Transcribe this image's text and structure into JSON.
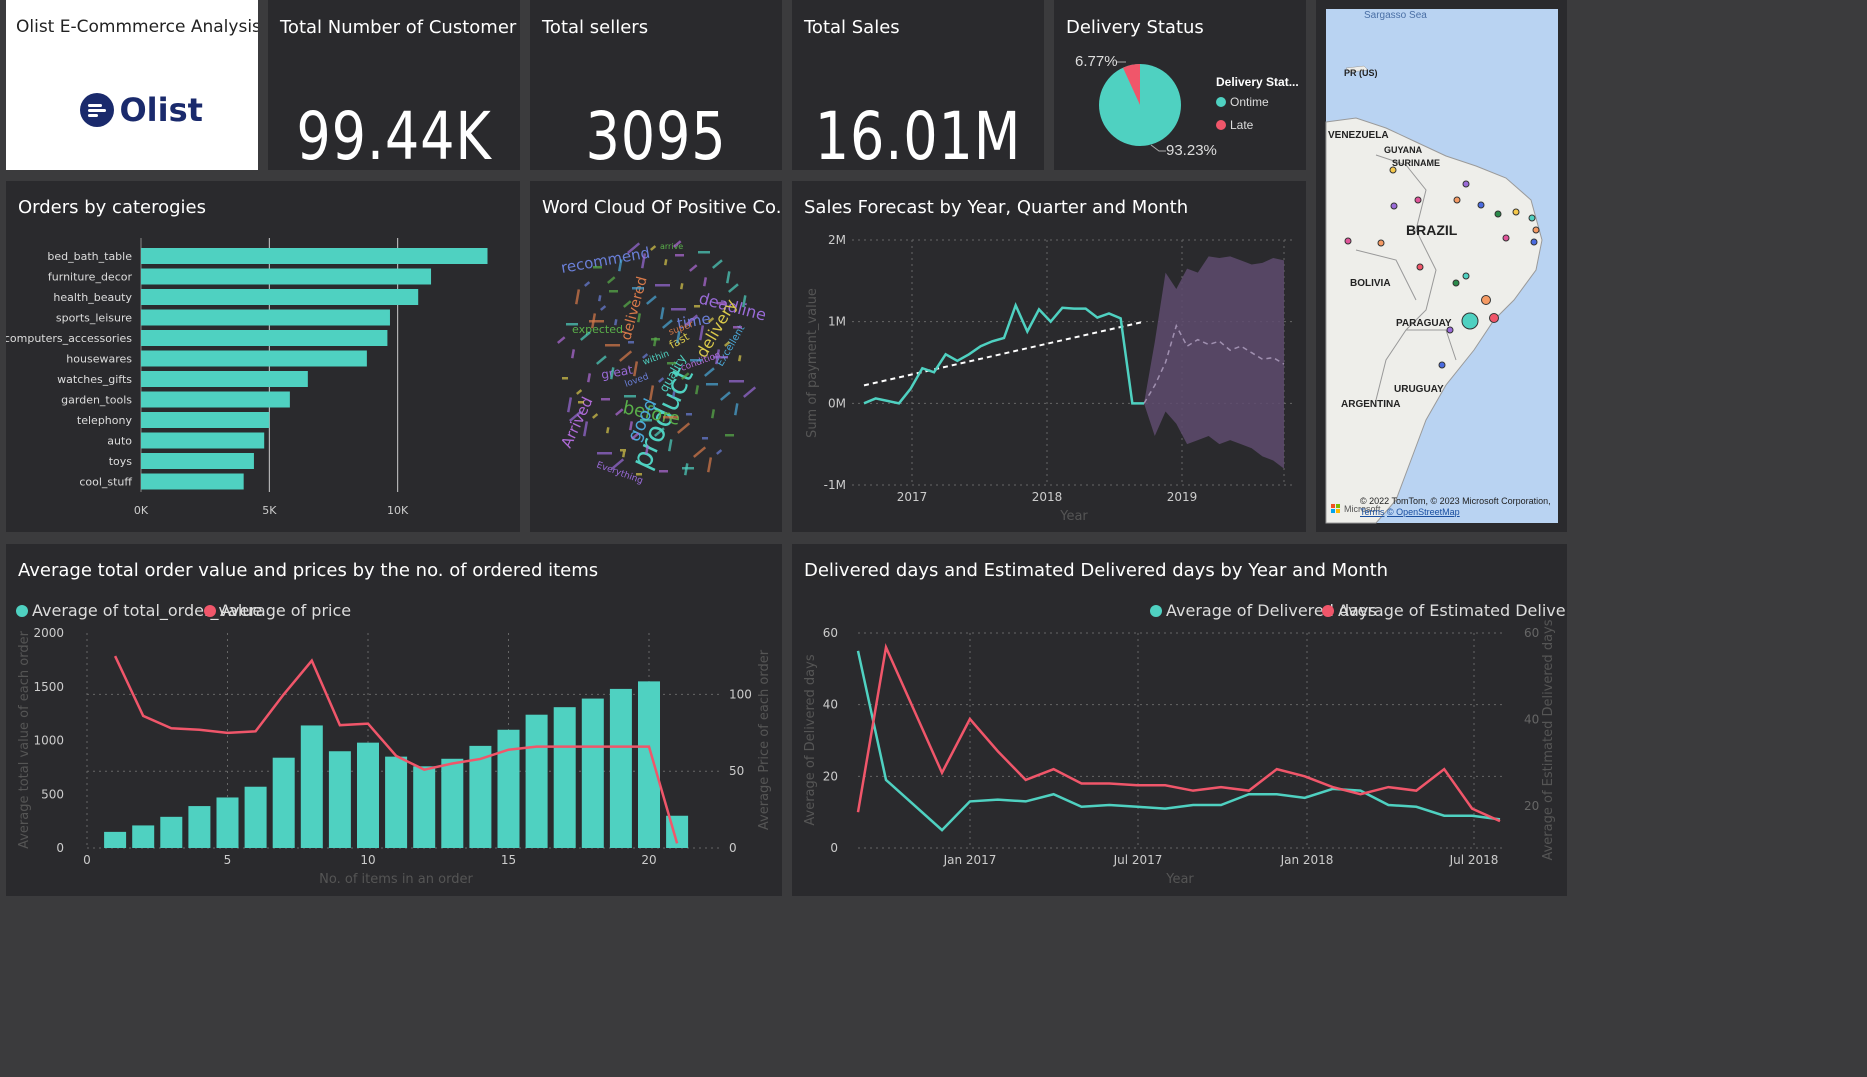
{
  "colors": {
    "teal": "#4fd1c1",
    "red": "#f0566a",
    "purple": "#5e4b6e",
    "panel": "#2a2a2d",
    "bg": "#3b3b3d"
  },
  "header": {
    "title": "Olist E-Commmerce Analysis",
    "logo_text": "Olist"
  },
  "kpis": {
    "customers": {
      "title": "Total Number of Customer",
      "value": "99.44K"
    },
    "sellers": {
      "title": "Total sellers",
      "value": "3095"
    },
    "sales": {
      "title": "Total Sales",
      "value": "16.01M"
    }
  },
  "delivery_status": {
    "title": "Delivery Status",
    "legend_title": "Delivery Stat...",
    "legend": [
      "Ontime",
      "Late"
    ],
    "late_label": "6.77%",
    "ontime_label": "93.23%"
  },
  "wordcloud": {
    "title": "Word Cloud Of Positive Co...",
    "words": [
      "recommend",
      "deadline",
      "product",
      "before",
      "delivery",
      "delivered",
      "good",
      "Arrived",
      "time",
      "great",
      "quality",
      "expected",
      "fast",
      "super",
      "Excellent",
      "condition",
      "loved",
      "Everything",
      "within",
      "arrive"
    ]
  },
  "map": {
    "top_label": "Sargasso Sea",
    "labels": [
      "PR (US)",
      "VENEZUELA",
      "GUYANA",
      "SURINAME",
      "BRAZIL",
      "BOLIVIA",
      "PARAGUAY",
      "URUGUAY",
      "ARGENTINA"
    ],
    "attribution": "© 2022 TomTom, © 2023 Microsoft Corporation,",
    "terms": "Terms",
    "osm": "© OpenStreetMap",
    "ms_logo_text": "Microsoft"
  },
  "chart_data": [
    {
      "id": "orders_by_category",
      "type": "bar",
      "title": "Orders by caterogies",
      "categories": [
        "bed_bath_table",
        "furniture_decor",
        "health_beauty",
        "sports_leisure",
        "computers_accessories",
        "housewares",
        "watches_gifts",
        "garden_tools",
        "telephony",
        "auto",
        "toys",
        "cool_stuff"
      ],
      "values": [
        13500,
        11300,
        10800,
        9700,
        9600,
        8800,
        6500,
        5800,
        5000,
        4800,
        4400,
        4000
      ],
      "xticks": [
        "0K",
        "5K",
        "10K"
      ],
      "xlim": [
        0,
        15000
      ],
      "orientation": "horizontal",
      "color": "#4fd1c1"
    },
    {
      "id": "sales_forecast",
      "type": "line",
      "title": "Sales Forecast by Year, Quarter and Month",
      "xlabel": "Year",
      "ylabel": "Sum of payment_value",
      "yticks": [
        "2M",
        "1M",
        "0M",
        "-1M"
      ],
      "xticks": [
        "2017",
        "2018",
        "2019"
      ],
      "ylim": [
        -1000000,
        2000000
      ],
      "actual": [
        0,
        60000,
        30000,
        0,
        180000,
        430000,
        380000,
        600000,
        520000,
        600000,
        700000,
        760000,
        800000,
        1200000,
        880000,
        1150000,
        1000000,
        1170000,
        1160000,
        1160000,
        1050000,
        1100000,
        1040000,
        0,
        0
      ],
      "forecast": [
        0,
        220000,
        500000,
        950000,
        700000,
        780000,
        720000,
        760000,
        650000,
        700000,
        620000,
        540000,
        560000,
        480000
      ],
      "upper": [
        0,
        750000,
        1600000,
        1400000,
        1650000,
        1600000,
        1800000,
        1780000,
        1800000,
        1750000,
        1700000,
        1720000,
        1780000,
        1750000
      ],
      "lower": [
        0,
        -400000,
        -100000,
        -250000,
        -500000,
        -450000,
        -400000,
        -500000,
        -450000,
        -500000,
        -550000,
        -650000,
        -700000,
        -800000
      ],
      "trend": [
        220000,
        1000000
      ],
      "forecast_band_color": "#5e4b6e"
    },
    {
      "id": "avg_order_value",
      "type": "bar",
      "title": "Average total order value and prices by the no. of ordered items",
      "xlabel": "No. of items in an order",
      "ylabel": "Average total value of each order",
      "y2label": "Average Price of each order",
      "legend": [
        "Average of total_order_value",
        "Average of price"
      ],
      "x": [
        1,
        2,
        3,
        4,
        5,
        6,
        7,
        8,
        9,
        10,
        11,
        12,
        13,
        14,
        15,
        16,
        17,
        18,
        19,
        20,
        21
      ],
      "series": [
        {
          "name": "Average of total_order_value",
          "type": "bar",
          "values": [
            150,
            210,
            290,
            390,
            470,
            570,
            840,
            1140,
            900,
            980,
            850,
            760,
            830,
            950,
            1100,
            1240,
            1310,
            1390,
            1480,
            1550,
            300
          ]
        },
        {
          "name": "Average of price",
          "type": "line",
          "axis": "right",
          "values": [
            125,
            86,
            78,
            77,
            75,
            76,
            100,
            122,
            80,
            81,
            60,
            51,
            55,
            58,
            64,
            66,
            66,
            66,
            66,
            66,
            3
          ]
        }
      ],
      "yticks": [
        "2000",
        "1500",
        "1000",
        "500",
        "0"
      ],
      "y2ticks": [
        "100",
        "50",
        "0"
      ],
      "xticks": [
        "0",
        "5",
        "10",
        "15",
        "20"
      ],
      "ylim": [
        0,
        2000
      ],
      "y2lim": [
        0,
        140
      ]
    },
    {
      "id": "delivered_days",
      "type": "line",
      "title": "Delivered days and Estimated Delivered days by Year and Month",
      "xlabel": "Year",
      "ylabel": "Average of Delivered days",
      "y2label": "Average of Estimated Delivered days",
      "legend": [
        "Average of Delivered days",
        "Average of Estimated Delivered days"
      ],
      "x": [
        "Sep 2016",
        "Oct 2016",
        "Dec 2016",
        "Jan 2017",
        "Feb 2017",
        "Mar 2017",
        "Apr 2017",
        "May 2017",
        "Jun 2017",
        "Jul 2017",
        "Aug 2017",
        "Sep 2017",
        "Oct 2017",
        "Nov 2017",
        "Dec 2017",
        "Jan 2018",
        "Feb 2018",
        "Mar 2018",
        "Apr 2018",
        "May 2018",
        "Jun 2018",
        "Jul 2018",
        "Aug 2018",
        "Sep 2018"
      ],
      "xticks": [
        "Jan 2017",
        "Jul 2017",
        "Jan 2018",
        "Jul 2018"
      ],
      "series": [
        {
          "name": "Average of Delivered days",
          "values": [
            55,
            19,
            5,
            13,
            13.5,
            13,
            15,
            11.5,
            12,
            11.5,
            11,
            12,
            12,
            15,
            15,
            14,
            16.5,
            16,
            12,
            11.5,
            9,
            9,
            8
          ]
        },
        {
          "name": "Average of Estimated Delivered days",
          "values": [
            10,
            56,
            21,
            36,
            27,
            19,
            22,
            18,
            18,
            17.5,
            17.5,
            16,
            17,
            16,
            22,
            20,
            17,
            15,
            17,
            16,
            22,
            11,
            7.5
          ]
        }
      ],
      "yticks": [
        "60",
        "40",
        "20",
        "0"
      ],
      "y2ticks": [
        "60",
        "40",
        "20"
      ],
      "ylim": [
        0,
        60
      ]
    }
  ]
}
